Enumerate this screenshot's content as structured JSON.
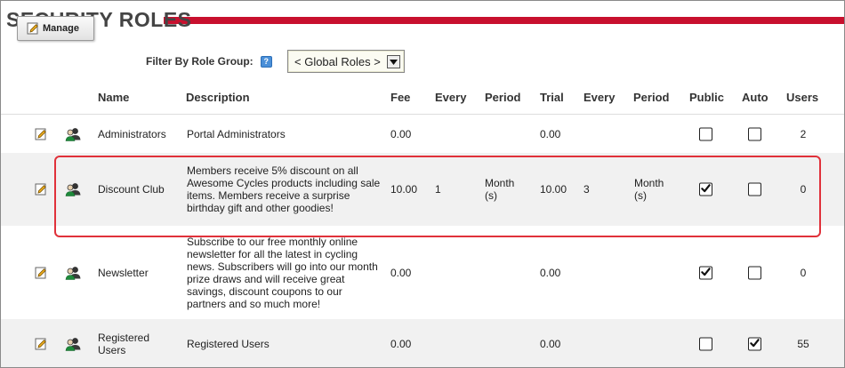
{
  "header": {
    "title": "SECURITY ROLES",
    "manage_label": "Manage"
  },
  "filter": {
    "label": "Filter By Role Group:",
    "help_glyph": "?",
    "selected": "< Global Roles >"
  },
  "columns": {
    "name": "Name",
    "description": "Description",
    "fee": "Fee",
    "every": "Every",
    "period": "Period",
    "trial": "Trial",
    "trial_every": "Every",
    "trial_period": "Period",
    "public": "Public",
    "auto": "Auto",
    "users": "Users"
  },
  "rows": [
    {
      "name": "Administrators",
      "description": "Portal Administrators",
      "fee": "0.00",
      "every": "",
      "period": "",
      "trial": "0.00",
      "trial_every": "",
      "trial_period": "",
      "public": false,
      "auto": false,
      "users": "2"
    },
    {
      "name": "Discount Club",
      "description": "Members receive 5% discount on all Awesome Cycles products including sale items. Members receive a surprise birthday gift and other goodies!",
      "fee": "10.00",
      "every": "1",
      "period": "Month (s)",
      "trial": "10.00",
      "trial_every": "3",
      "trial_period": "Month (s)",
      "public": true,
      "auto": false,
      "users": "0"
    },
    {
      "name": "Newsletter",
      "description": "Subscribe to our free monthly online newsletter for all the latest in cycling news. Subscribers will go into our month prize draws and will receive great savings, discount coupons to our partners and so much more!",
      "fee": "0.00",
      "every": "",
      "period": "",
      "trial": "0.00",
      "trial_every": "",
      "trial_period": "",
      "public": true,
      "auto": false,
      "users": "0"
    },
    {
      "name": "Registered Users",
      "description": "Registered Users",
      "fee": "0.00",
      "every": "",
      "period": "",
      "trial": "0.00",
      "trial_every": "",
      "trial_period": "",
      "public": false,
      "auto": true,
      "users": "55"
    }
  ],
  "icons": {
    "edit": "pencil-icon",
    "role": "role-group-icon",
    "help": "help-icon",
    "dropdown": "chevron-down-icon"
  },
  "colors": {
    "accent_rule": "#c8102e",
    "highlight_border": "#e0313a",
    "alt_row": "#f1f1f1"
  }
}
